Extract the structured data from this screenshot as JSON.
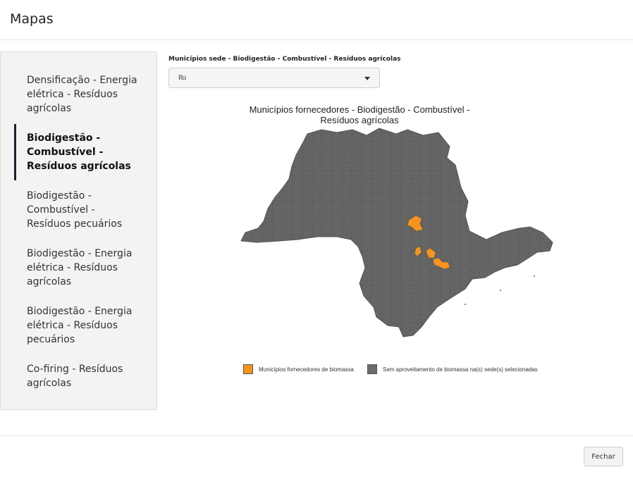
{
  "modal": {
    "title": "Mapas"
  },
  "sidebar": {
    "items": [
      {
        "label": "Densificação - Energia elétrica - Resíduos agrícolas",
        "active": false
      },
      {
        "label": "Biodigestão - Combustível - Resíduos agrícolas",
        "active": true
      },
      {
        "label": "Biodigestão - Combustível - Resíduos pecuários",
        "active": false
      },
      {
        "label": "Biodigestão - Energia elétrica - Resíduos agrícolas",
        "active": false
      },
      {
        "label": "Biodigestão - Energia elétrica - Resíduos pecuários",
        "active": false
      },
      {
        "label": "Co-firing - Resíduos agrícolas",
        "active": false
      }
    ]
  },
  "select": {
    "label": "Municípios sede - Biodigestão - Combustível - Resíduos agrícolas",
    "value": "Itu"
  },
  "map": {
    "title": "Municípios fornecedores - Biodigestão - Combustível - Resíduos agrícolas",
    "colors": {
      "supplier": "#f7941d",
      "base": "#666666",
      "border": "#555555"
    },
    "legend": [
      {
        "label": "Municípios fornecedores de biomassa",
        "color": "#f7941d"
      },
      {
        "label": "Sem aproveitamento de biomassa na(s) sede(s) selecionadas",
        "color": "#6b6b6b"
      }
    ]
  },
  "footer": {
    "close_label": "Fechar"
  }
}
